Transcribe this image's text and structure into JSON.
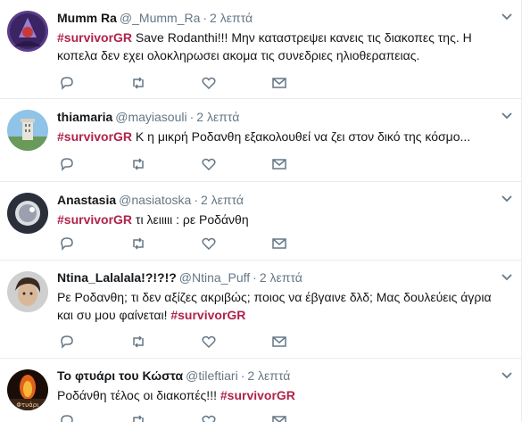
{
  "tweets": [
    {
      "name": "Mumm Ra",
      "handle": "@_Mumm_Ra",
      "time": "2 λεπτά",
      "parts": [
        {
          "text": "#survivorGR",
          "tag": true
        },
        {
          "text": " Save Rodanthi!!! Μην καταστρεψει κανεις τις διακοπες της. Η",
          "tag": false
        }
      ],
      "line2": [
        {
          "text": "κοπελα δεν εχει ολοκληρωσει ακομα τις συνεδριες ηλιοθεραπειας.",
          "tag": false
        }
      ]
    },
    {
      "name": "thiamaria",
      "handle": "@mayiasouli",
      "time": "2 λεπτά",
      "parts": [
        {
          "text": "#survivorGR",
          "tag": true
        },
        {
          "text": " Κ η μικρή Ροδανθη εξακολουθεί να ζει στον δικό της κόσμο...",
          "tag": false
        }
      ]
    },
    {
      "name": "Anastasia",
      "handle": "@nasiatoska",
      "time": "2 λεπτά",
      "parts": [
        {
          "text": "#survivorGR",
          "tag": true
        },
        {
          "text": " τι λειιιιι : ρε Ροδάνθη",
          "tag": false
        }
      ]
    },
    {
      "name": "Ntina_Lalalala!?!?!?",
      "handle": "@Ntina_Puff",
      "time": "2 λεπτά",
      "parts": [
        {
          "text": "Ρε Ροδανθη; τι δεν αξίζες ακριβώς; ποιος να έβγαινε δλδ; Μας δουλεύεις άγρια",
          "tag": false
        }
      ],
      "line2": [
        {
          "text": "και συ μου φαίνεται! ",
          "tag": false
        },
        {
          "text": "#survivorGR",
          "tag": true
        }
      ]
    },
    {
      "name": "Το φτυάρι του Κώστα",
      "handle": "@tileftiari",
      "time": "2 λεπτά",
      "parts": [
        {
          "text": "Ροδάνθη τέλος οι διακοπές!!! ",
          "tag": false
        },
        {
          "text": "#survivorGR",
          "tag": true
        }
      ]
    }
  ],
  "last_avatar_text": "Φτυάρι",
  "colors": {
    "hashtag": "#b0234a",
    "muted": "#657786",
    "text": "#14171a",
    "divider": "#e6ecf0"
  },
  "icons": [
    "reply-icon",
    "retweet-icon",
    "like-icon",
    "message-icon",
    "chevron-down-icon"
  ]
}
